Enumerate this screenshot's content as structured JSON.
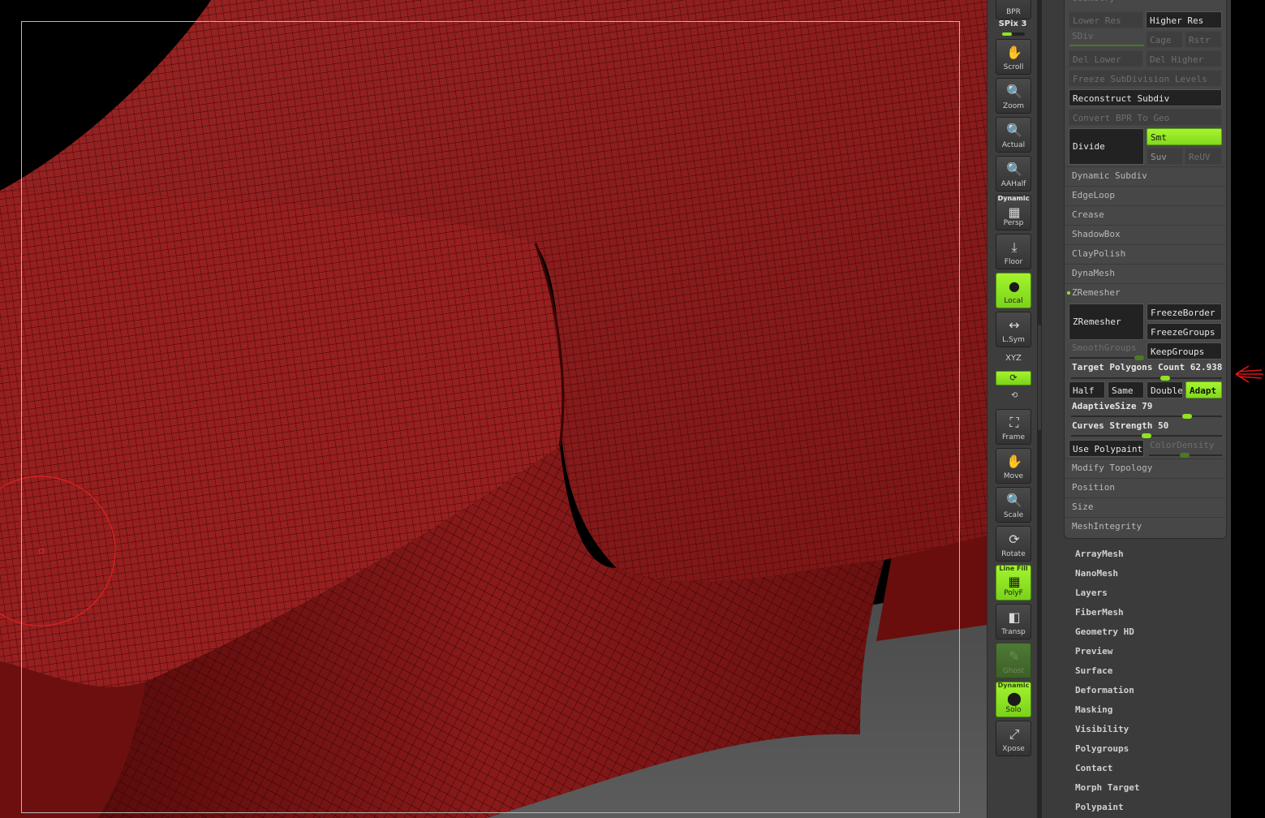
{
  "shelf": {
    "bpr": "BPR",
    "spix_label": "SPix 3",
    "spix_value": 0.5,
    "scroll": "Scroll",
    "zoom": "Zoom",
    "actual": "Actual",
    "aahalf": "AAHalf",
    "dynamic": "Dynamic",
    "persp": "Persp",
    "floor": "Floor",
    "local": "Local",
    "lsym": "L.Sym",
    "xyz": "XYZ",
    "frame": "Frame",
    "move": "Move",
    "scale": "Scale",
    "rotate": "Rotate",
    "linefill": "Line Fill",
    "polyf": "PolyF",
    "transp": "Transp",
    "ghost": "Ghost",
    "solo_top": "Dynamic",
    "solo": "Solo",
    "xpose": "Xpose"
  },
  "geometry": {
    "title": "Geometry",
    "lower_res": "Lower Res",
    "higher_res": "Higher Res",
    "sdiv": "SDiv",
    "cage": "Cage",
    "rstr": "Rstr",
    "del_lower": "Del Lower",
    "del_higher": "Del Higher",
    "freeze_subdiv": "Freeze SubDivision Levels",
    "reconstruct_subdiv": "Reconstruct Subdiv",
    "convert_bpr": "Convert BPR To Geo",
    "divide": "Divide",
    "smt": "Smt",
    "suv": "Suv",
    "reuv": "ReUV",
    "sections": [
      "Dynamic Subdiv",
      "EdgeLoop",
      "Crease",
      "ShadowBox",
      "ClayPolish",
      "DynaMesh"
    ],
    "zremesher_header": "ZRemesher",
    "zremesher_btn": "ZRemesher",
    "freeze_border": "FreezeBorder",
    "freeze_groups": "FreezeGroups",
    "smooth_groups": "SmoothGroups",
    "keep_groups": "KeepGroups",
    "target_label": "Target Polygons Count 62.9384",
    "target_value": 0.63,
    "half": "Half",
    "same": "Same",
    "double": "Double",
    "adapt": "Adapt",
    "adaptive_label": "AdaptiveSize 79",
    "adaptive_value": 79,
    "curves_label": "Curves Strength 50",
    "curves_value": 50,
    "use_polypaint": "Use Polypaint",
    "color_density": "ColorDensity",
    "sections_after": [
      "Modify Topology",
      "Position",
      "Size",
      "MeshIntegrity"
    ]
  },
  "subpalettes": [
    "ArrayMesh",
    "NanoMesh",
    "Layers",
    "FiberMesh",
    "Geometry HD",
    "Preview",
    "Surface",
    "Deformation",
    "Masking",
    "Visibility",
    "Polygroups",
    "Contact",
    "Morph Target",
    "Polypaint"
  ],
  "colors": {
    "accent": "#8fe421",
    "mesh": "#8c1a1a",
    "arrow": "#e01515"
  }
}
